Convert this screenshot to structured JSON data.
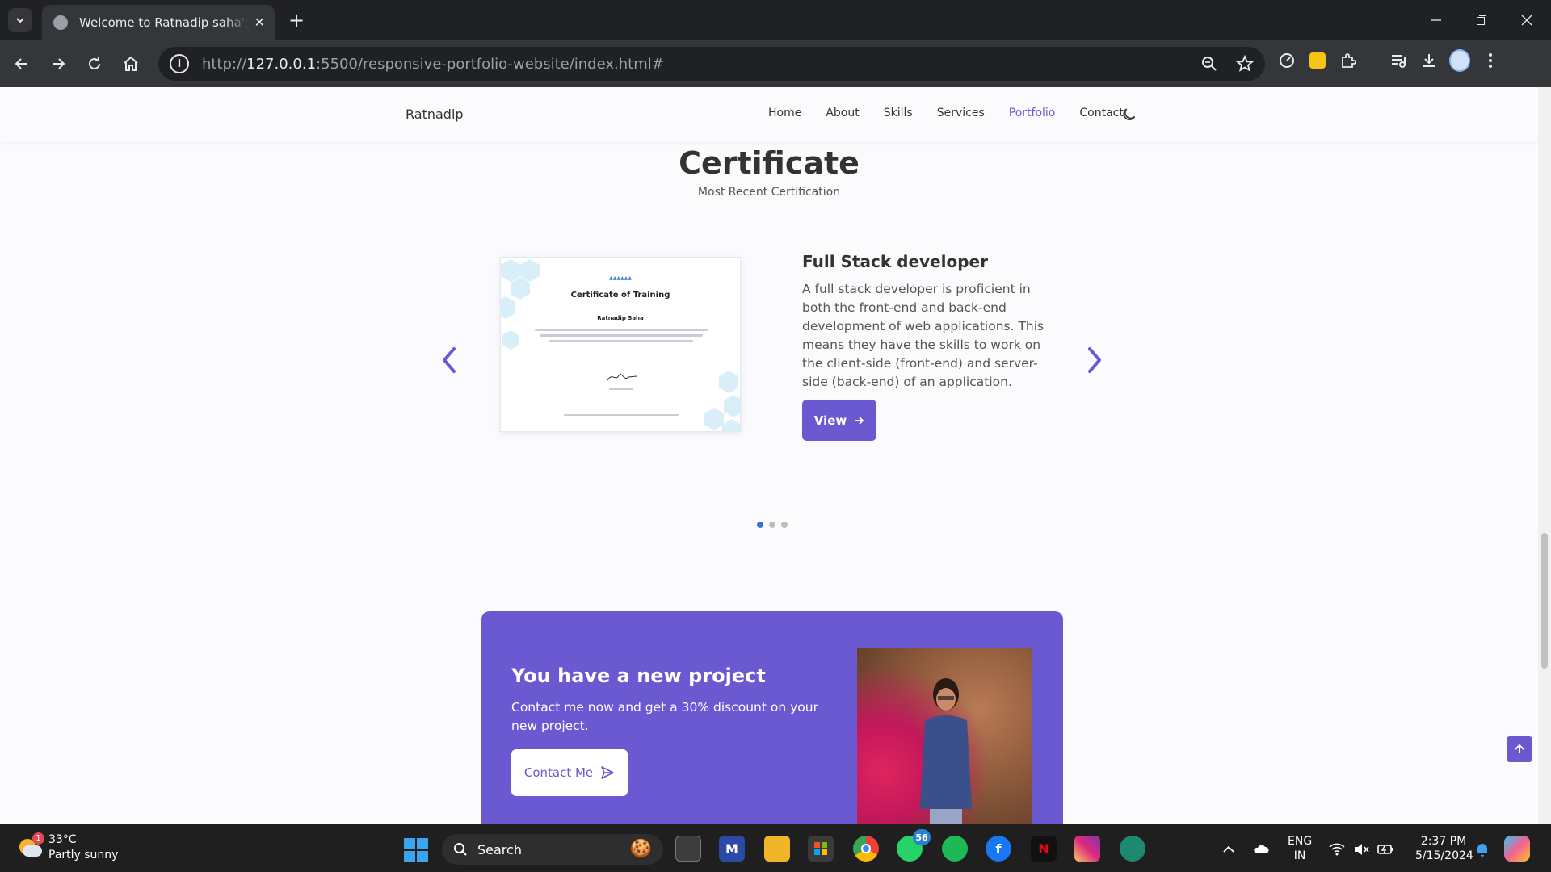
{
  "browser": {
    "tab_title": "Welcome to Ratnadip saha's portfolio",
    "url_prefix": "http://",
    "url_host": "127.0.0.1",
    "url_rest": ":5500/responsive-portfolio-website/index.html#"
  },
  "site": {
    "logo": "Ratnadip",
    "nav": [
      "Home",
      "About",
      "Skills",
      "Services",
      "Portfolio",
      "Contact"
    ],
    "active_nav": "Portfolio"
  },
  "certificate_section": {
    "title": "Certificate",
    "subtitle": "Most Recent Certification",
    "slide": {
      "title": "Full Stack developer",
      "description": "A full stack developer is proficient in both the front-end and back-end development of web applications. This means they have the skills to work on the client-side (front-end) and server-side (back-end) of an application.",
      "button_label": "View",
      "image": {
        "heading": "Certificate of Training",
        "recipient": "Ratnadip Saha"
      }
    },
    "dots_total": 3,
    "dots_active": 1
  },
  "project_box": {
    "title": "You have a new project",
    "description": "Contact me now and get a 30% discount on your new project.",
    "button_label": "Contact Me"
  },
  "colors": {
    "accent": "#6a59d1",
    "page_bg": "#fbfbfe"
  },
  "taskbar": {
    "temperature": "33°C",
    "weather": "Partly sunny",
    "weather_badge": "1",
    "search_placeholder": "Search",
    "whatsapp_badge": "56",
    "lang_line1": "ENG",
    "lang_line2": "IN",
    "time": "2:37 PM",
    "date": "5/15/2024"
  }
}
